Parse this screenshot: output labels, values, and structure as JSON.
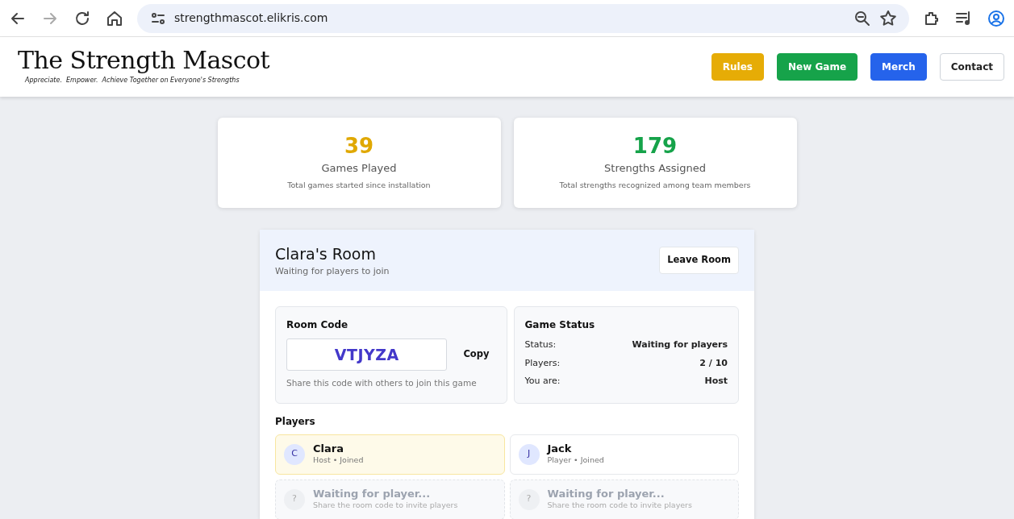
{
  "browser": {
    "url": "strengthmascot.elikris.com"
  },
  "site": {
    "title": "The Strength Mascot",
    "tagline": "Appreciate.  Empower.  Achieve Together on Everyone's Strengths"
  },
  "nav_buttons": [
    {
      "label": "Rules",
      "kind": "warning"
    },
    {
      "label": "New Game",
      "kind": "success"
    },
    {
      "label": "Merch",
      "kind": "primary"
    },
    {
      "label": "Contact",
      "kind": "outline"
    }
  ],
  "stats": [
    {
      "value": "39",
      "label": "Games Played",
      "note": "Total games started since installation",
      "color": "#e0a800"
    },
    {
      "value": "179",
      "label": "Strengths Assigned",
      "note": "Total strengths recognized among team members",
      "color": "#16a34a"
    }
  ],
  "room": {
    "title": "Clara's Room",
    "subtitle": "Waiting for players to join",
    "leave_button": "Leave Room",
    "code_panel": {
      "heading": "Room Code",
      "code": "VTJYZA",
      "copy_button": "Copy",
      "hint": "Share this code with others to join this game"
    },
    "status_panel": {
      "heading": "Game Status",
      "rows": [
        {
          "label": "Status:",
          "value": "Waiting for players"
        },
        {
          "label": "Players:",
          "value": "2 / 10"
        },
        {
          "label": "You are:",
          "value": "Host"
        }
      ]
    },
    "players_heading": "Players",
    "players": [
      {
        "kind": "joined",
        "avatar": "C",
        "name": "Clara",
        "detail": "Host • Joined",
        "selected": true
      },
      {
        "kind": "joined",
        "avatar": "J",
        "name": "Jack",
        "detail": "Player • Joined",
        "selected": false
      },
      {
        "kind": "empty",
        "avatar": "?",
        "name": "Waiting for player...",
        "detail": "Share the room code to invite players",
        "selected": false
      },
      {
        "kind": "empty",
        "avatar": "?",
        "name": "Waiting for player...",
        "detail": "Share the room code to invite players",
        "selected": false
      }
    ]
  }
}
